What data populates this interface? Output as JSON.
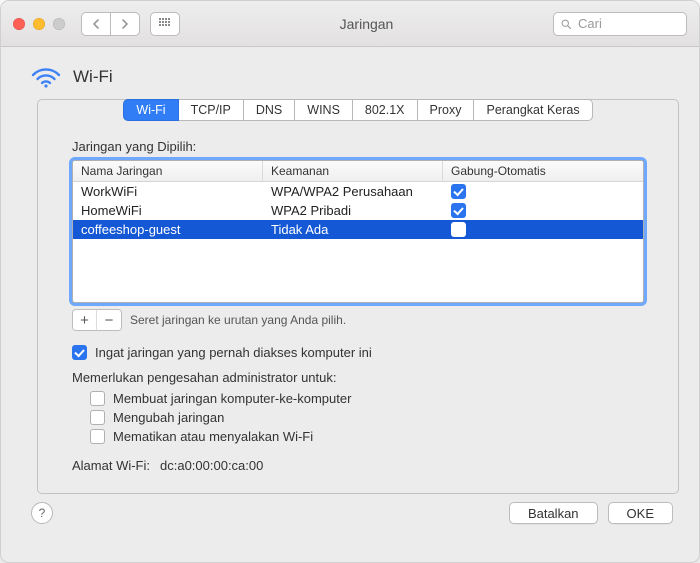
{
  "window": {
    "title": "Jaringan",
    "search_placeholder": "Cari"
  },
  "header": {
    "title": "Wi-Fi"
  },
  "tabs": [
    "Wi-Fi",
    "TCP/IP",
    "DNS",
    "WINS",
    "802.1X",
    "Proxy",
    "Perangkat Keras"
  ],
  "active_tab": 0,
  "preferred_label": "Jaringan yang Dipilih:",
  "columns": {
    "name": "Nama Jaringan",
    "security": "Keamanan",
    "auto": "Gabung-Otomatis"
  },
  "networks": [
    {
      "name": "WorkWiFi",
      "security": "WPA/WPA2 Perusahaan",
      "auto": true,
      "selected": false
    },
    {
      "name": "HomeWiFi",
      "security": "WPA2 Pribadi",
      "auto": true,
      "selected": false
    },
    {
      "name": "coffeeshop-guest",
      "security": "Tidak Ada",
      "auto": false,
      "selected": true
    }
  ],
  "drag_hint": "Seret jaringan ke urutan yang Anda pilih.",
  "remember_label": "Ingat jaringan yang pernah diakses komputer ini",
  "remember_checked": true,
  "admin_label": "Memerlukan pengesahan administrator untuk:",
  "admin_opts": [
    {
      "label": "Membuat jaringan komputer-ke-komputer",
      "checked": false
    },
    {
      "label": "Mengubah jaringan",
      "checked": false
    },
    {
      "label": "Mematikan atau menyalakan Wi-Fi",
      "checked": false
    }
  ],
  "wifi_address_label": "Alamat Wi-Fi:",
  "wifi_address_value": "dc:a0:00:00:ca:00",
  "buttons": {
    "cancel": "Batalkan",
    "ok": "OKE"
  }
}
